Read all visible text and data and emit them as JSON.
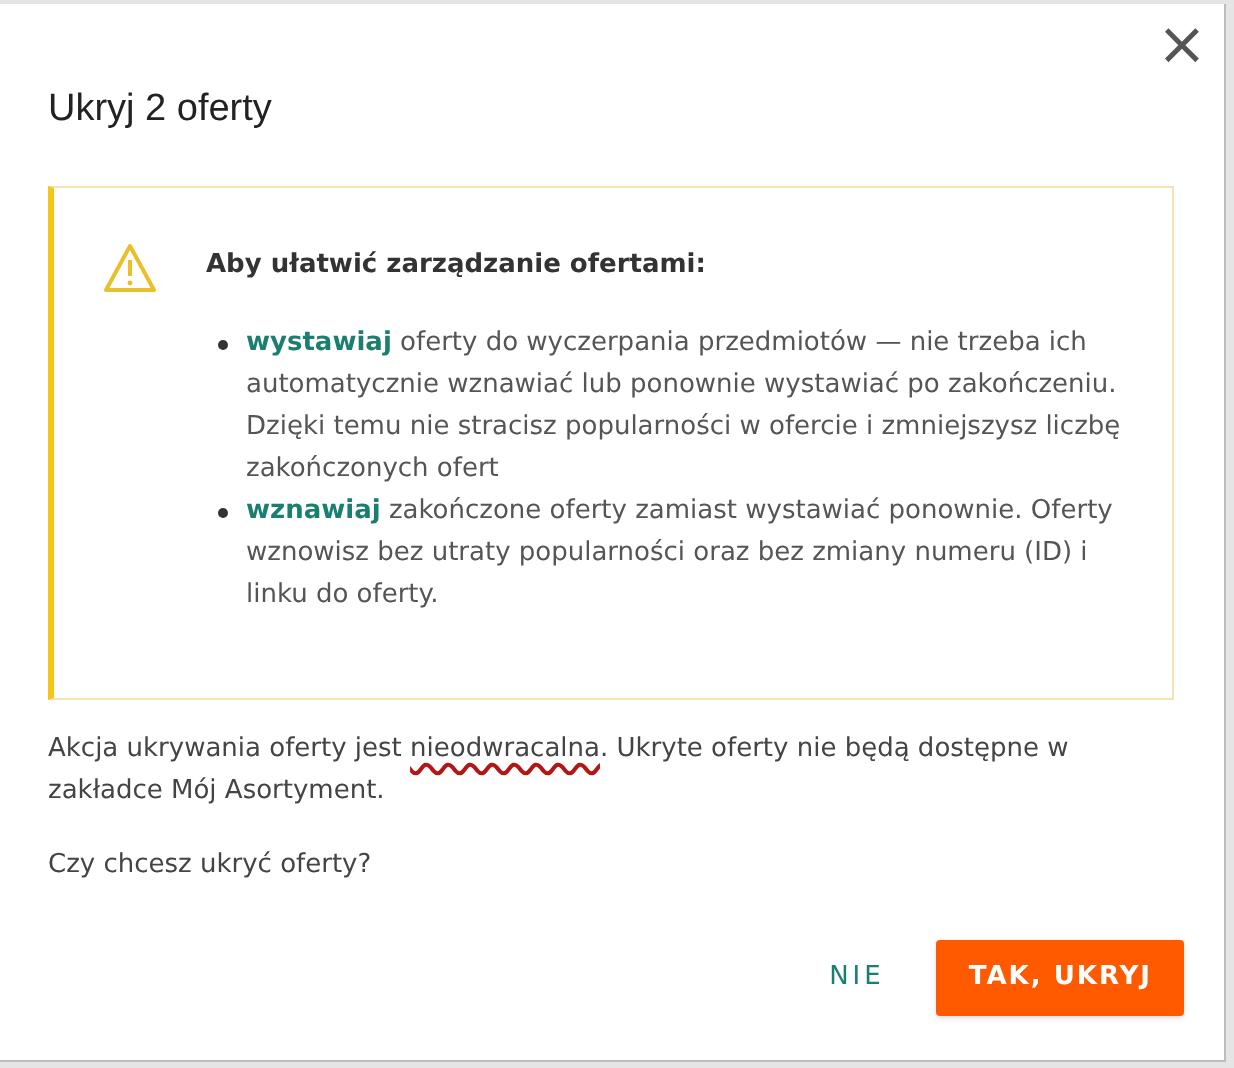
{
  "dialog": {
    "title": "Ukryj 2 oferty",
    "close": "×"
  },
  "alert": {
    "heading": "Aby ułatwić zarządzanie ofertami:",
    "items": [
      {
        "lead": "wystawiaj",
        "text": "oferty do wyczerpania przedmiotów — nie trzeba ich automatycznie wznawiać lub ponownie wystawiać po zakończeniu. Dzięki temu nie stracisz popularności w ofercie i zmniejszysz liczbę zakończonych ofert"
      },
      {
        "lead": "wznawiaj",
        "text": "zakończone oferty zamiast wystawiać ponownie. Oferty wznowisz bez utraty popularności oraz bez zmiany numeru (ID) i linku do oferty."
      }
    ]
  },
  "notice": {
    "parts": [
      {
        "text": "Akcja ukrywania oferty jest ",
        "underlined": false
      },
      {
        "text": "nieodwracalna",
        "underlined": true
      },
      {
        "text": ". Ukryte oferty nie będą dostępne w zakładce Mój Asortyment.",
        "underlined": false
      }
    ]
  },
  "question": "Czy chcesz ukryć oferty?",
  "buttons": [
    {
      "label": "NIE",
      "kind": "text"
    },
    {
      "label": "TAK, UKRYJ",
      "kind": "primary"
    }
  ]
}
